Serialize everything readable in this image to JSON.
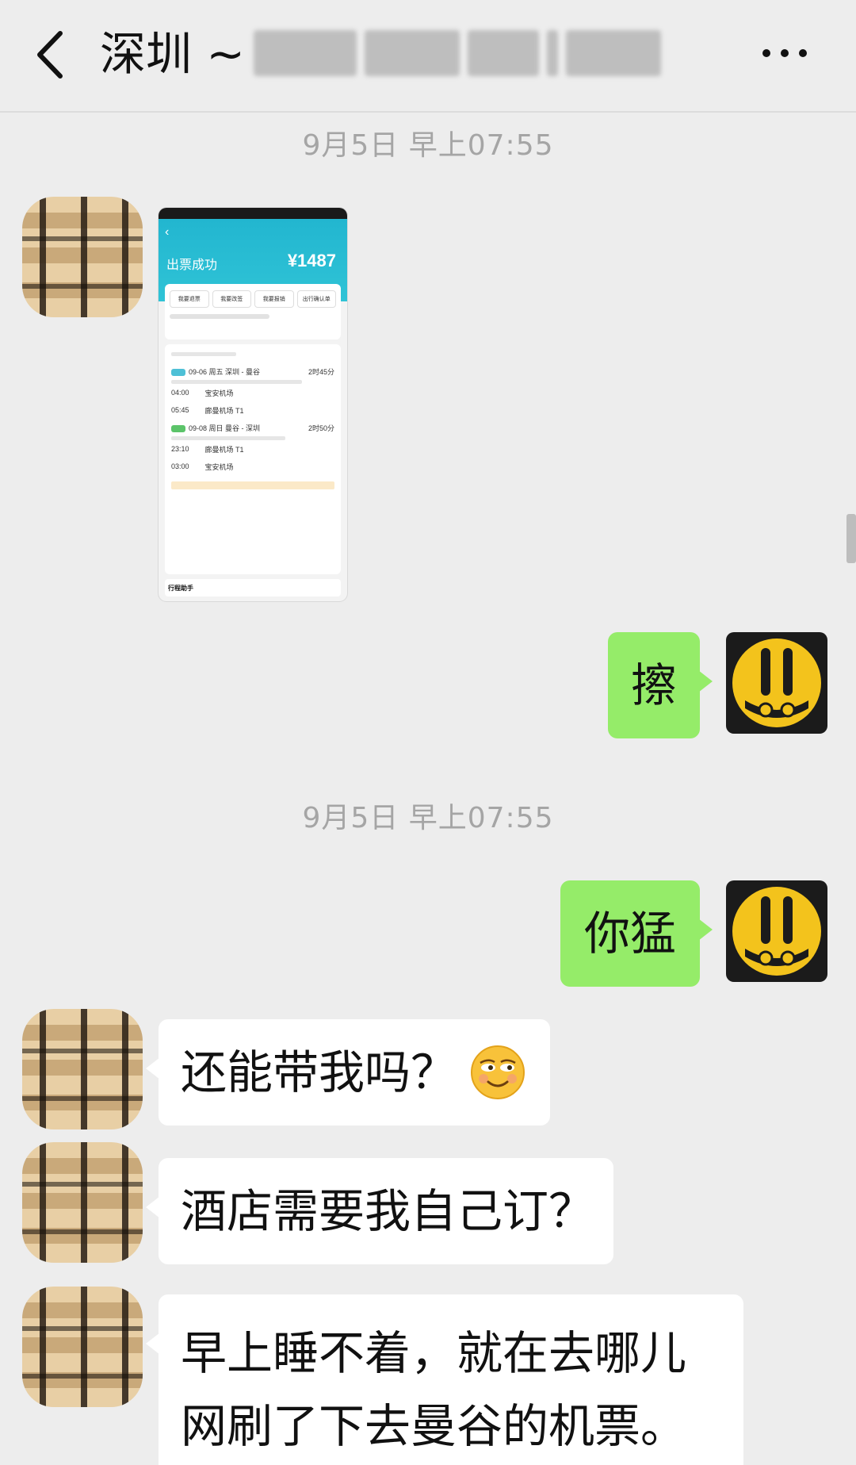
{
  "header": {
    "back_icon": "chevron-left-icon",
    "title": "深圳 ~",
    "more_icon": "more-dots-icon"
  },
  "timestamps": [
    "9月5日 早上07:55",
    "9月5日 早上07:55"
  ],
  "messages": [
    {
      "side": "left",
      "type": "image",
      "content": "flight-ticket-screenshot"
    },
    {
      "side": "right",
      "text": "擦"
    },
    {
      "side": "right",
      "text": "你猛"
    },
    {
      "side": "left",
      "text": "还能带我吗？",
      "emoji": "smirk-emoji-icon"
    },
    {
      "side": "left",
      "text": "酒店需要我自己订？"
    },
    {
      "side": "left",
      "lines": [
        "早上睡不着，就在去哪儿",
        "网刷了下去曼谷的机票。"
      ]
    }
  ],
  "ticket": {
    "title": "出票成功",
    "price": "¥1487",
    "buttons": [
      "我要退票",
      "我要改签",
      "我要报销",
      "出行确认单"
    ],
    "segment1_date": "09-06 周五 深圳 - 曼谷",
    "segment1_duration": "2时45分",
    "segment1_dep_time": "04:00",
    "segment1_dep_airport": "宝安机场",
    "segment1_arr_time": "05:45",
    "segment1_arr_airport": "廊曼机场 T1",
    "segment2_date": "09-08 周日 曼谷 - 深圳",
    "segment2_duration": "2时50分",
    "segment2_dep_time": "23:10",
    "segment2_dep_airport": "廊曼机场 T1",
    "segment2_arr_time": "03:00",
    "segment2_arr_airport": "宝安机场",
    "footer": "行程助手"
  },
  "colors": {
    "background": "#ededed",
    "sent_bubble": "#95ec69",
    "received_bubble": "#ffffff",
    "timestamp": "#a5a5a5"
  }
}
